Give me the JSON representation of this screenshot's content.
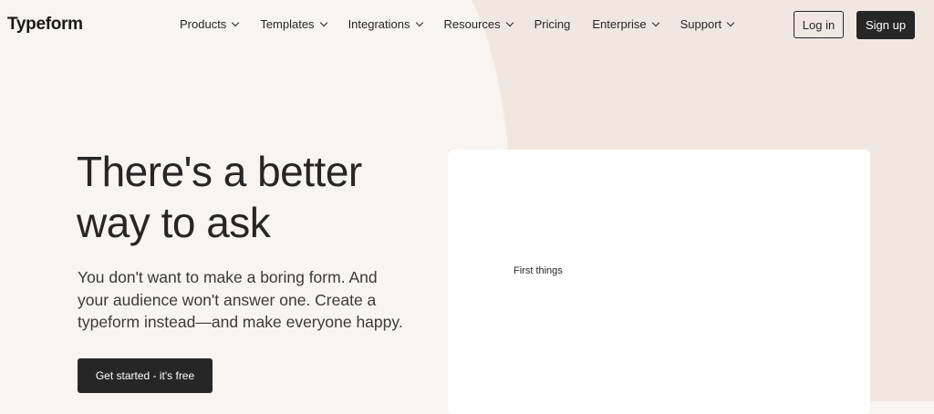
{
  "header": {
    "logo": "Typeform",
    "nav": [
      {
        "label": "Products",
        "dropdown": true,
        "icon": "chevron-down-icon"
      },
      {
        "label": "Templates",
        "dropdown": true,
        "icon": "chevron-down-icon"
      },
      {
        "label": "Integrations",
        "dropdown": true,
        "icon": "chevron-down-icon"
      },
      {
        "label": "Resources",
        "dropdown": true,
        "icon": "chevron-down-icon"
      },
      {
        "label": "Pricing",
        "dropdown": false
      },
      {
        "label": "Enterprise",
        "dropdown": true,
        "icon": "chevron-down-icon"
      },
      {
        "label": "Support",
        "dropdown": true,
        "icon": "chevron-down-icon"
      }
    ],
    "login_label": "Log in",
    "signup_label": "Sign up"
  },
  "hero": {
    "title_line1": "There's a better",
    "title_line2": "way to ask",
    "subtitle_line1": "You don't want to make a boring form. And",
    "subtitle_line2": "your audience won't answer one. Create a",
    "subtitle_line3": "typeform instead—and make everyone happy.",
    "cta_label": "Get started - it's free"
  },
  "preview": {
    "text": "First things"
  },
  "colors": {
    "background": "#f7f4f1",
    "background_shape": "#f0e6e0",
    "dark": "#262627",
    "card": "#ffffff"
  }
}
